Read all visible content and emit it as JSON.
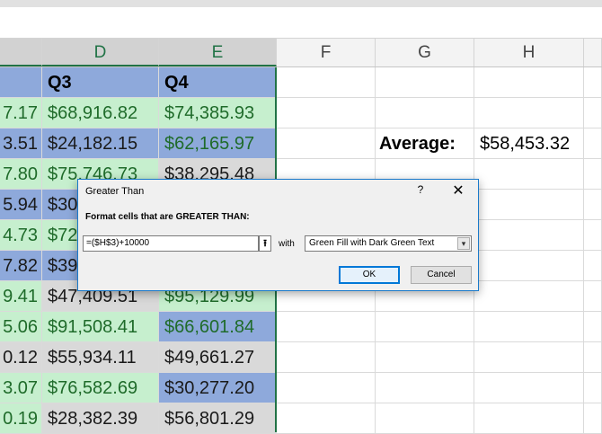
{
  "columns": [
    {
      "letter": "D",
      "selected": true
    },
    {
      "letter": "E",
      "selected": true
    },
    {
      "letter": "F",
      "selected": false
    },
    {
      "letter": "G",
      "selected": false
    },
    {
      "letter": "H",
      "selected": false
    }
  ],
  "rows": [
    {
      "c": "",
      "d": "Q3",
      "e": "Q4",
      "style": [
        "hdr",
        "hdr",
        "hdr"
      ]
    },
    {
      "c": "7.17",
      "d": "$68,916.82",
      "e": "$74,385.93",
      "style": [
        "green",
        "green",
        "green"
      ]
    },
    {
      "c": "3.51",
      "d": "$24,182.15",
      "e": "$62,165.97",
      "style": [
        "blue",
        "blue",
        "blue-g"
      ]
    },
    {
      "c": "7.80",
      "d": "$75,746.73",
      "e": "$38,295.48",
      "style": [
        "green",
        "green",
        "grey"
      ]
    },
    {
      "c": "5.94",
      "d": "$30",
      "e": "",
      "style": [
        "blue",
        "blue",
        "blue"
      ]
    },
    {
      "c": "4.73",
      "d": "$72",
      "e": "",
      "style": [
        "green",
        "green",
        "green"
      ]
    },
    {
      "c": "7.82",
      "d": "$39",
      "e": "",
      "style": [
        "blue",
        "blue",
        "blue"
      ]
    },
    {
      "c": "9.41",
      "d": "$47,409.51",
      "e": "$95,129.99",
      "style": [
        "green",
        "grey",
        "green"
      ]
    },
    {
      "c": "5.06",
      "d": "$91,508.41",
      "e": "$66,601.84",
      "style": [
        "green",
        "green",
        "blue-g"
      ]
    },
    {
      "c": "0.12",
      "d": "$55,934.11",
      "e": "$49,661.27",
      "style": [
        "grey",
        "grey",
        "grey"
      ]
    },
    {
      "c": "3.07",
      "d": "$76,582.69",
      "e": "$30,277.20",
      "style": [
        "green",
        "green",
        "blue"
      ]
    },
    {
      "c": "0.19",
      "d": "$28,382.39",
      "e": "$56,801.29",
      "style": [
        "green",
        "grey",
        "grey"
      ]
    }
  ],
  "average": {
    "label": "Average:",
    "value": "$58,453.32"
  },
  "dialog": {
    "title": "Greater Than",
    "help": "?",
    "close": "✕",
    "prompt": "Format cells that are GREATER THAN:",
    "input_value": "=($H$3)+10000",
    "range_button": "⭱",
    "with_label": "with",
    "format_selected": "Green Fill with Dark Green Text",
    "ok_label": "OK",
    "cancel_label": "Cancel"
  },
  "colors": {
    "green_fill": "#c6efce",
    "green_text": "#1f6b2a",
    "blue_fill": "#8ea9db",
    "grey_fill": "#d9d9d9",
    "selection": "#217346"
  }
}
